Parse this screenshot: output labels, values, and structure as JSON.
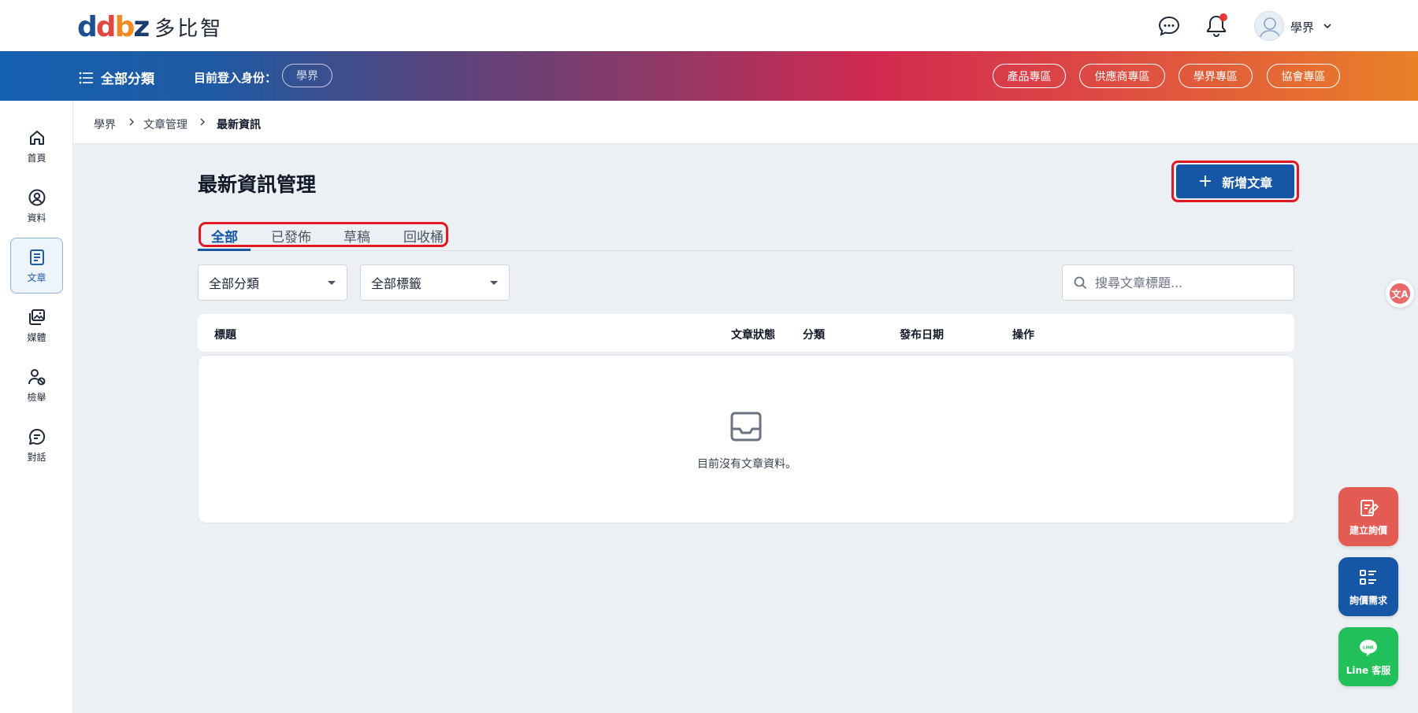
{
  "header": {
    "logo_mark": {
      "d1": "d",
      "d2": "b",
      "d3": "b",
      "z": "z"
    },
    "logo_text": "多比智",
    "user_name": "學界"
  },
  "navbar": {
    "all_categories": "全部分類",
    "login_label": "目前登入身份：",
    "role": "學界",
    "zones": [
      "產品專區",
      "供應商專區",
      "學界專區",
      "協會專區"
    ]
  },
  "sidebar": {
    "items": [
      {
        "label": "首頁",
        "icon": "home-icon"
      },
      {
        "label": "資料",
        "icon": "user-circle-icon"
      },
      {
        "label": "文章",
        "icon": "document-icon",
        "active": true
      },
      {
        "label": "媒體",
        "icon": "media-icon"
      },
      {
        "label": "檢舉",
        "icon": "report-user-icon"
      },
      {
        "label": "對話",
        "icon": "chat-bubble-icon"
      }
    ]
  },
  "breadcrumb": [
    "學界",
    "文章管理",
    "最新資訊"
  ],
  "main": {
    "title": "最新資訊管理",
    "add_button": "新增文章",
    "tabs": [
      "全部",
      "已發佈",
      "草稿",
      "回收桶"
    ],
    "active_tab": "全部",
    "filter_category": "全部分類",
    "filter_tag": "全部標籤",
    "search_placeholder": "搜尋文章標題...",
    "columns": [
      "標題",
      "文章狀態",
      "分類",
      "發布日期",
      "操作"
    ],
    "empty_text": "目前沒有文章資料。"
  },
  "floating": {
    "translate": "文A",
    "inquiry_create": "建立詢價",
    "inquiry_demand": "詢價需求",
    "line_service": "Line 客服",
    "line_badge": "LINE"
  },
  "colors": {
    "primary": "#1557a6",
    "highlight": "#e01a22",
    "inquiry_create": "#e35b52",
    "inquiry_demand": "#1557a6",
    "line": "#22c05a"
  }
}
